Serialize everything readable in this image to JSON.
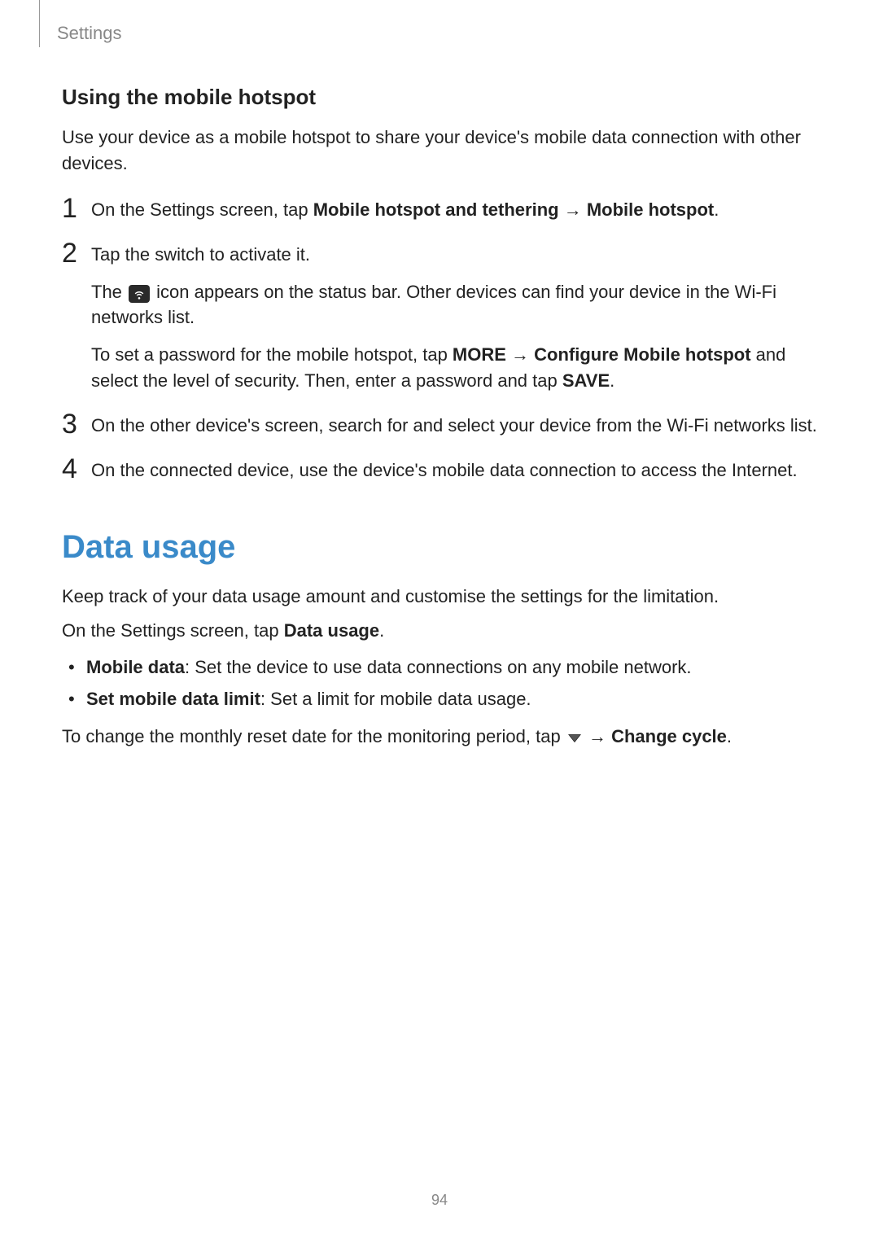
{
  "header": {
    "section": "Settings"
  },
  "subheading": "Using the mobile hotspot",
  "intro": "Use your device as a mobile hotspot to share your device's mobile data connection with other devices.",
  "steps": {
    "n1": "1",
    "s1_a": "On the Settings screen, tap ",
    "s1_b": "Mobile hotspot and tethering",
    "s1_c": " → ",
    "s1_d": "Mobile hotspot",
    "s1_e": ".",
    "n2": "2",
    "s2_a": "Tap the switch to activate it.",
    "s2_b_pre": "The ",
    "s2_b_post": " icon appears on the status bar. Other devices can find your device in the Wi-Fi networks list.",
    "s2_c_a": "To set a password for the mobile hotspot, tap ",
    "s2_c_b": "MORE",
    "s2_c_c": " → ",
    "s2_c_d": "Configure Mobile hotspot",
    "s2_c_e": " and select the level of security. Then, enter a password and tap ",
    "s2_c_f": "SAVE",
    "s2_c_g": ".",
    "n3": "3",
    "s3": "On the other device's screen, search for and select your device from the Wi-Fi networks list.",
    "n4": "4",
    "s4": "On the connected device, use the device's mobile data connection to access the Internet."
  },
  "section2": {
    "title": "Data usage",
    "p1": "Keep track of your data usage amount and customise the settings for the limitation.",
    "p2_a": "On the Settings screen, tap ",
    "p2_b": "Data usage",
    "p2_c": ".",
    "bullets": {
      "b1_label": "Mobile data",
      "b1_text": ": Set the device to use data connections on any mobile network.",
      "b2_label": "Set mobile data limit",
      "b2_text": ": Set a limit for mobile data usage."
    },
    "p3_a": "To change the monthly reset date for the monitoring period, tap ",
    "p3_b": " → ",
    "p3_c": "Change cycle",
    "p3_d": "."
  },
  "page": "94"
}
